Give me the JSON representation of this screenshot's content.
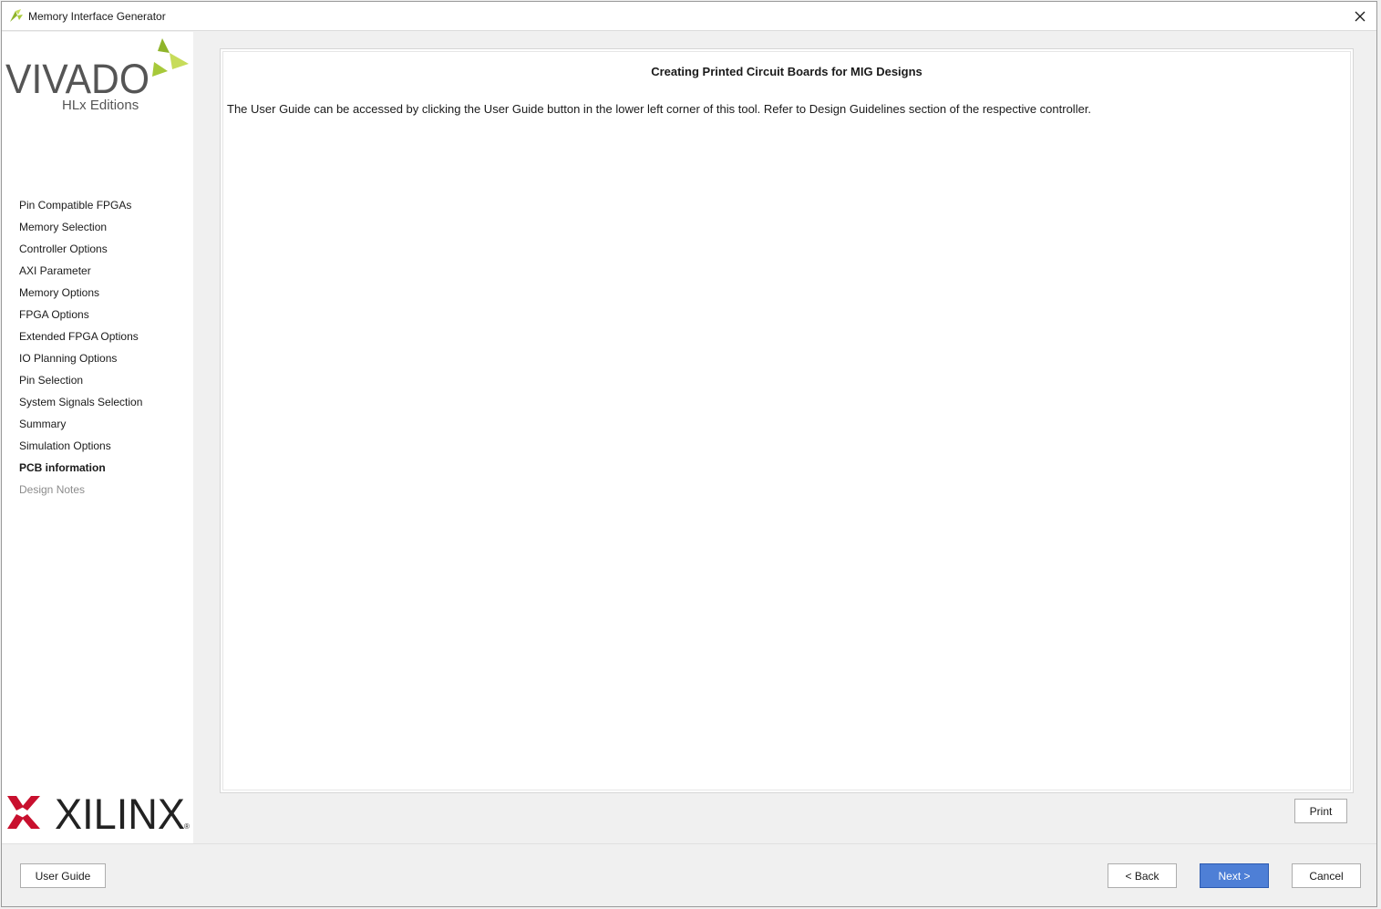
{
  "window": {
    "title": "Memory Interface Generator"
  },
  "sidebar": {
    "steps": [
      {
        "label": "Pin Compatible FPGAs",
        "state": "done"
      },
      {
        "label": "Memory Selection",
        "state": "done"
      },
      {
        "label": "Controller Options",
        "state": "done"
      },
      {
        "label": "AXI Parameter",
        "state": "done"
      },
      {
        "label": "Memory Options",
        "state": "done"
      },
      {
        "label": "FPGA Options",
        "state": "done"
      },
      {
        "label": "Extended FPGA Options",
        "state": "done"
      },
      {
        "label": "IO Planning Options",
        "state": "done"
      },
      {
        "label": "Pin Selection",
        "state": "done"
      },
      {
        "label": "System Signals Selection",
        "state": "done"
      },
      {
        "label": "Summary",
        "state": "done"
      },
      {
        "label": "Simulation Options",
        "state": "done"
      },
      {
        "label": "PCB information",
        "state": "current"
      },
      {
        "label": "Design Notes",
        "state": "disabled"
      }
    ],
    "vivado_logo": {
      "word": "VIVADO",
      "sub": "HLx Editions"
    },
    "xilinx_logo": {
      "word": "XILINX",
      "mark": "®"
    }
  },
  "main": {
    "heading": "Creating Printed Circuit Boards for MIG Designs",
    "body": "The User Guide can be accessed by clicking the User Guide button in the lower left corner of this tool. Refer to Design Guidelines section of the respective controller."
  },
  "buttons": {
    "print": "Print",
    "user_guide": "User Guide",
    "back": "< Back",
    "next": "Next >",
    "cancel": "Cancel"
  },
  "colors": {
    "next_button": "#4e7fd6",
    "vivado_leaf": "#a7c93a",
    "xilinx_red": "#c8102e"
  }
}
